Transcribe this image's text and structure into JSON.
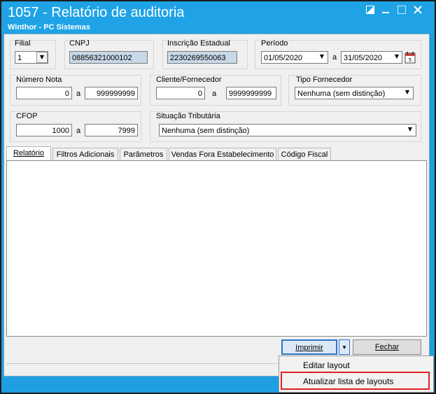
{
  "window": {
    "title": "1057 - Relatório de auditoria",
    "subtitle": "Winthor - PC Sistemas",
    "controls": {
      "restore_icon": "restore-icon",
      "minimize_icon": "minimize-icon",
      "maximize_icon": "maximize-icon",
      "close_icon": "close-icon"
    }
  },
  "filters": {
    "filial": {
      "label": "Filial",
      "value": "1"
    },
    "cnpj": {
      "label": "CNPJ",
      "value": "08856321000102"
    },
    "inscricao": {
      "label": "Inscrição Estadual",
      "value": "2230269550063"
    },
    "periodo": {
      "label": "Período",
      "from": "01/05/2020",
      "sep": "a",
      "to": "31/05/2020"
    },
    "numero_nota": {
      "label": "Número Nota",
      "from": "0",
      "sep": "a",
      "to": "999999999"
    },
    "cliente_fornecedor": {
      "label": "Cliente/Fornecedor",
      "from": "0",
      "sep": "a",
      "to": "9999999999"
    },
    "tipo_fornecedor": {
      "label": "Tipo Fornecedor",
      "value": "Nenhuma (sem distinção)"
    },
    "cfop": {
      "label": "CFOP",
      "from": "1000",
      "sep": "a",
      "to": "7999"
    },
    "situacao_tributaria": {
      "label": "Situação Tributária",
      "value": "Nenhuma (sem distinção)"
    }
  },
  "tabs": [
    {
      "label": "Relatório",
      "active": true
    },
    {
      "label": "Filtros Adicionais"
    },
    {
      "label": "Parâmetros"
    },
    {
      "label": "Vendas Fora Estabelecimento"
    },
    {
      "label": "Código Fiscal"
    }
  ],
  "buttons": {
    "imprimir": "Imprimir",
    "fechar": "Fechar"
  },
  "menu": {
    "items": [
      "Editar layout",
      "Atualizar lista de layouts"
    ],
    "highlight_color": "#e02020"
  },
  "colors": {
    "titlebar": "#1fa3e6",
    "readonly_field": "#c7d9e8"
  }
}
